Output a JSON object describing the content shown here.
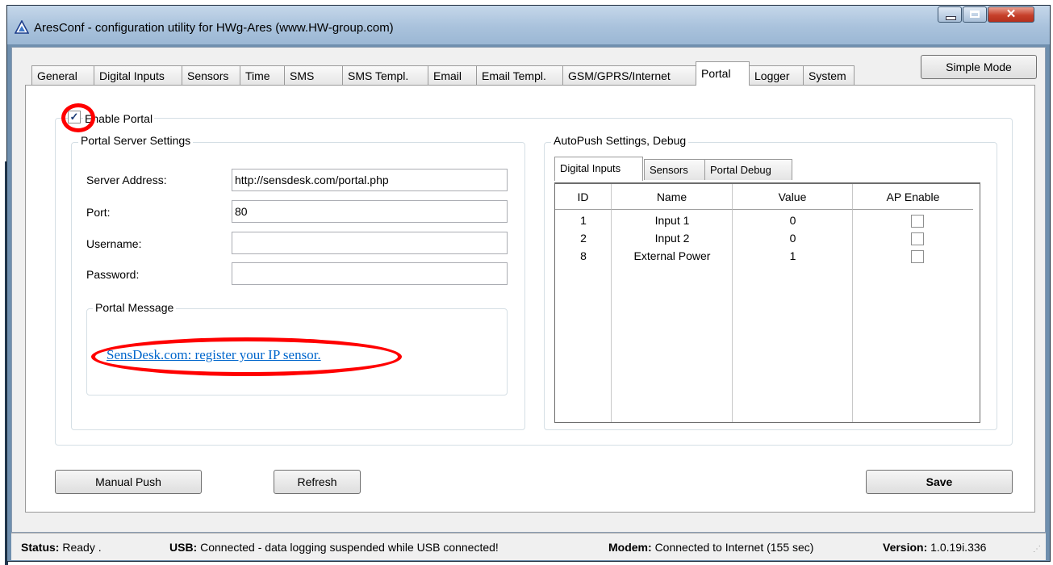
{
  "window": {
    "title": "AresConf - configuration utility for HWg-Ares (www.HW-group.com)"
  },
  "tabs": [
    "General",
    "Digital Inputs",
    "Sensors",
    "Time",
    "SMS",
    "SMS Templ.",
    "Email",
    "Email Templ.",
    "GSM/GPRS/Internet",
    "Portal",
    "Logger",
    "System"
  ],
  "active_tab": "Portal",
  "simple_mode_label": "Simple Mode",
  "portal": {
    "enable_label": "Enable Portal",
    "enabled": true,
    "server_group": "Portal Server Settings",
    "server_address_label": "Server Address:",
    "server_address": "http://sensdesk.com/portal.php",
    "port_label": "Port:",
    "port": "80",
    "username_label": "Username:",
    "username": "",
    "password_label": "Password:",
    "password": "",
    "message_group": "Portal Message",
    "message_link": "SensDesk.com: register your IP sensor."
  },
  "autopush": {
    "group": "AutoPush Settings, Debug",
    "tabs": [
      "Digital Inputs",
      "Sensors",
      "Portal Debug"
    ],
    "active_tab": "Digital Inputs",
    "columns": [
      "ID",
      "Name",
      "Value",
      "AP Enable"
    ],
    "rows": [
      {
        "id": "1",
        "name": "Input 1",
        "value": "0",
        "ap_enable": false
      },
      {
        "id": "2",
        "name": "Input 2",
        "value": "0",
        "ap_enable": false
      },
      {
        "id": "8",
        "name": "External Power",
        "value": "1",
        "ap_enable": false
      }
    ]
  },
  "buttons": {
    "manual_push": "Manual Push",
    "refresh": "Refresh",
    "save": "Save"
  },
  "status": {
    "status_label": "Status:",
    "status_value": "Ready .",
    "usb_label": "USB:",
    "usb_value": "Connected - data logging suspended while USB connected!",
    "modem_label": "Modem:",
    "modem_value": "Connected to Internet (155 sec)",
    "version_label": "Version:",
    "version_value": "1.0.19i.336"
  },
  "colors": {
    "annotation": "#ff0000",
    "link": "#0066cc",
    "titlebar": "#a9c2dc",
    "close": "#c6402b"
  }
}
